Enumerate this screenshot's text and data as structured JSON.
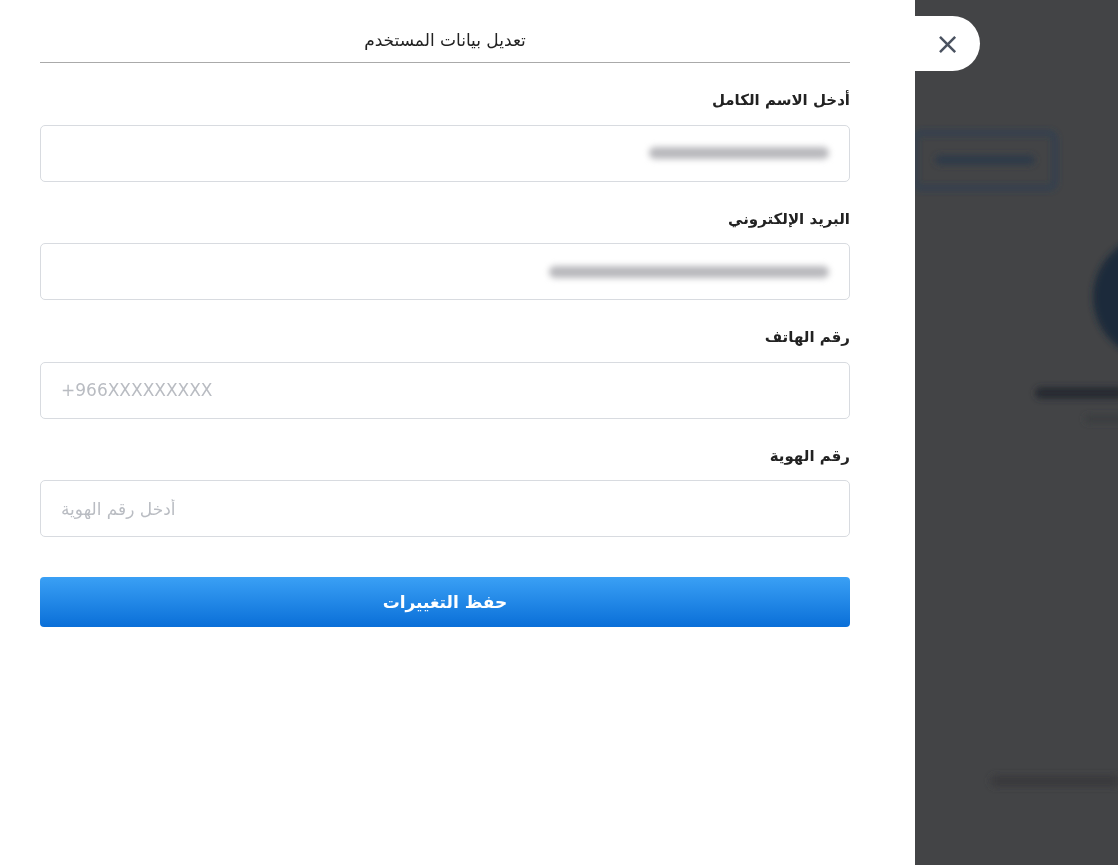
{
  "dialog": {
    "title": "تعديل بيانات المستخدم",
    "close": "×"
  },
  "fields": [
    {
      "label": "أدخل الاسم الكامل",
      "value_redacted": true
    },
    {
      "label": "البريد الإلكتروني",
      "value_redacted": true
    },
    {
      "label": "رقم الهاتف",
      "placeholder": "+966XXXXXXXXX"
    },
    {
      "label": "رقم الهوية",
      "placeholder": "أدخل رقم الهوية"
    }
  ],
  "submit": "حفظ التغييرات"
}
